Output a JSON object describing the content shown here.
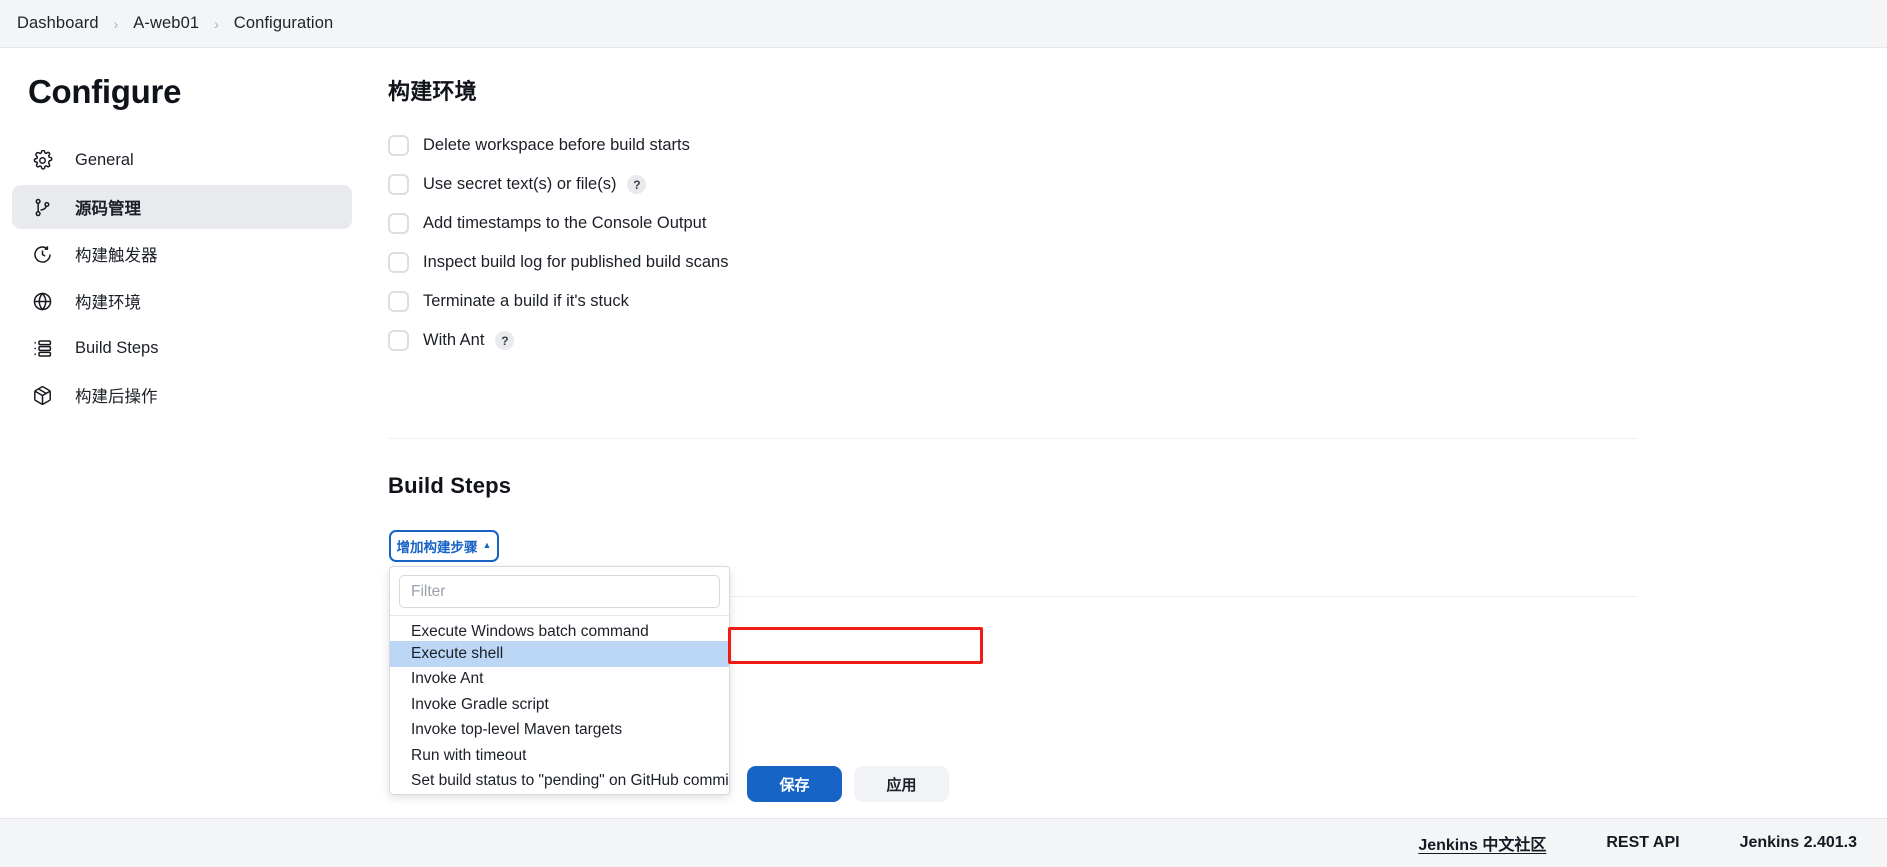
{
  "breadcrumb": {
    "items": [
      "Dashboard",
      "A-web01",
      "Configuration"
    ],
    "separator": "›"
  },
  "sidebar": {
    "title": "Configure",
    "items": [
      {
        "label": "General",
        "icon": "gear-icon",
        "active": false
      },
      {
        "label": "源码管理",
        "icon": "branch-icon",
        "active": true
      },
      {
        "label": "构建触发器",
        "icon": "clock-icon",
        "active": false
      },
      {
        "label": "构建环境",
        "icon": "globe-icon",
        "active": false
      },
      {
        "label": "Build Steps",
        "icon": "list-icon",
        "active": false
      },
      {
        "label": "构建后操作",
        "icon": "package-icon",
        "active": false
      }
    ]
  },
  "build_environment": {
    "heading": "构建环境",
    "options": [
      {
        "label": "Delete workspace before build starts",
        "checked": false,
        "help": false
      },
      {
        "label": "Use secret text(s) or file(s)",
        "checked": false,
        "help": true
      },
      {
        "label": "Add timestamps to the Console Output",
        "checked": false,
        "help": false
      },
      {
        "label": "Inspect build log for published build scans",
        "checked": false,
        "help": false
      },
      {
        "label": "Terminate a build if it's stuck",
        "checked": false,
        "help": false
      },
      {
        "label": "With Ant",
        "checked": false,
        "help": true
      }
    ],
    "help_glyph": "?"
  },
  "build_steps": {
    "heading": "Build Steps",
    "add_button_label": "增加构建步骤",
    "add_button_caret": "▲",
    "filter_placeholder": "Filter",
    "filter_value": "",
    "menu_items": [
      {
        "label": "Execute Windows batch command",
        "selected": false
      },
      {
        "label": "Execute shell",
        "selected": true
      },
      {
        "label": "Invoke Ant",
        "selected": false
      },
      {
        "label": "Invoke Gradle script",
        "selected": false
      },
      {
        "label": "Invoke top-level Maven targets",
        "selected": false
      },
      {
        "label": "Run with timeout",
        "selected": false
      },
      {
        "label": "Set build status to \"pending\" on GitHub commit",
        "selected": false
      }
    ]
  },
  "actions": {
    "save_label": "保存",
    "apply_label": "应用"
  },
  "footer": {
    "community_link": "Jenkins 中文社区",
    "rest_api_link": "REST API",
    "version": "Jenkins 2.401.3"
  },
  "colors": {
    "accent": "#1763c6",
    "annotation": "#ee1c14",
    "selected_row": "#bcd7f5",
    "sidebar_active": "#e9eaee",
    "chrome_bg": "#f4f5f7"
  }
}
